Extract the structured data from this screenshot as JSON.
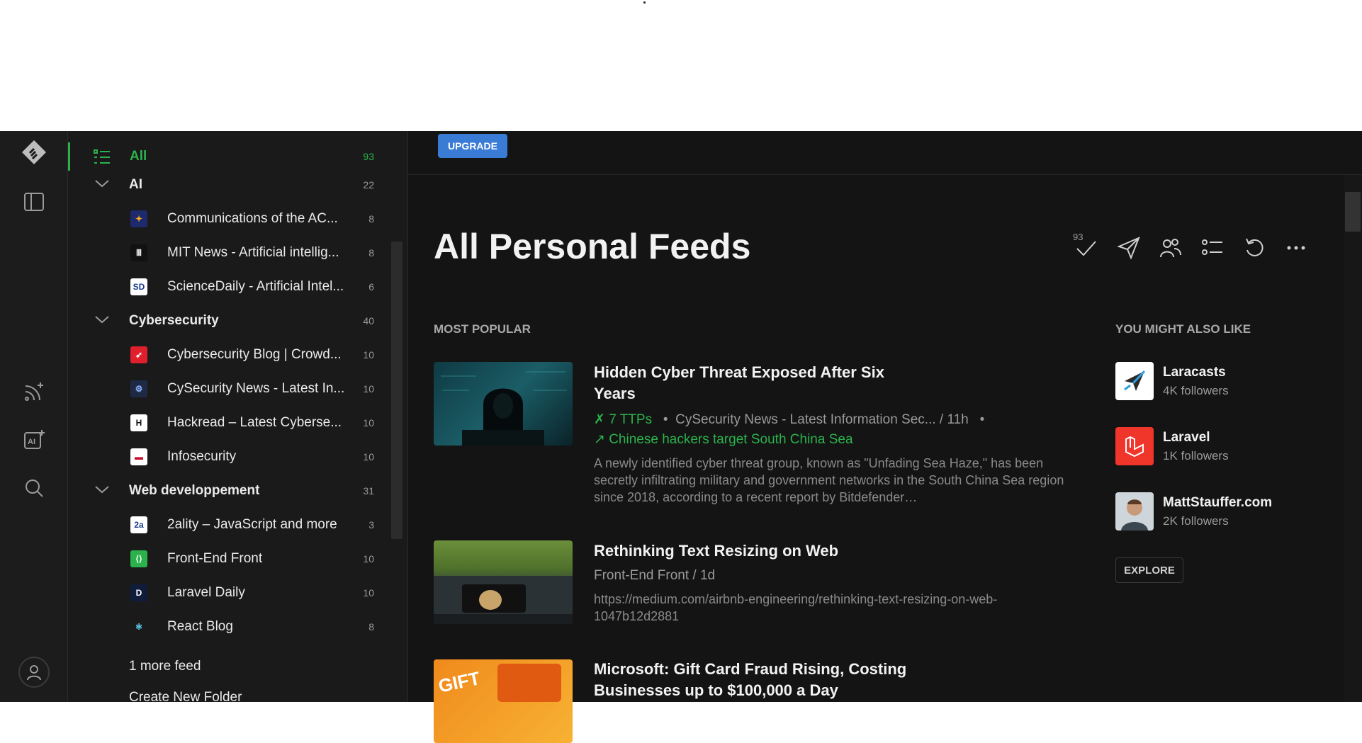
{
  "sidebar": {
    "all": {
      "label": "All",
      "count": "93"
    },
    "items": [
      {
        "type": "folder",
        "label": "AI",
        "count": "22"
      },
      {
        "type": "feed",
        "label": "Communications of the AC...",
        "count": "8",
        "icon": "acm-icon"
      },
      {
        "type": "feed",
        "label": "MIT News - Artificial intellig...",
        "count": "8",
        "icon": "mit-icon"
      },
      {
        "type": "feed",
        "label": "ScienceDaily - Artificial Intel...",
        "count": "6",
        "icon": "sciencedaily-icon"
      },
      {
        "type": "folder",
        "label": "Cybersecurity",
        "count": "40"
      },
      {
        "type": "feed",
        "label": "Cybersecurity Blog | Crowd...",
        "count": "10",
        "icon": "crowdstrike-icon"
      },
      {
        "type": "feed",
        "label": "CySecurity News - Latest In...",
        "count": "10",
        "icon": "cysecurity-icon"
      },
      {
        "type": "feed",
        "label": "Hackread – Latest Cyberse...",
        "count": "10",
        "icon": "hackread-icon"
      },
      {
        "type": "feed",
        "label": "Infosecurity",
        "count": "10",
        "icon": "infosecurity-icon"
      },
      {
        "type": "folder",
        "label": "Web developpement",
        "count": "31"
      },
      {
        "type": "feed",
        "label": "2ality – JavaScript and more",
        "count": "3",
        "icon": "2ality-icon"
      },
      {
        "type": "feed",
        "label": "Front-End Front",
        "count": "10",
        "icon": "frontendfront-icon"
      },
      {
        "type": "feed",
        "label": "Laravel Daily",
        "count": "10",
        "icon": "laraveldaily-icon"
      },
      {
        "type": "feed",
        "label": "React Blog",
        "count": "8",
        "icon": "react-icon"
      }
    ],
    "more": "1 more feed",
    "create_folder": "Create New Folder"
  },
  "main": {
    "upgrade": "UPGRADE",
    "title": "All Personal Feeds",
    "mark_read_count": "93",
    "most_popular": "MOST POPULAR",
    "articles": [
      {
        "title": "Hidden Cyber Threat Exposed After Six Years",
        "ttps": "7 TTPs",
        "source": "CySecurity News - Latest Information Sec... / 11h",
        "trend": "Chinese hackers target South China Sea",
        "desc": "A newly identified cyber threat group, known as \"Unfading Sea Haze,\" has been secretly infiltrating military and government networks in the South China Sea region since 2018, according to a recent report by Bitdefender…"
      },
      {
        "title": "Rethinking Text Resizing on Web",
        "source": "Front-End Front / 1d",
        "desc": "https://medium.com/airbnb-engineering/rethinking-text-resizing-on-web-1047b12d2881"
      },
      {
        "title": "Microsoft: Gift Card Fraud Rising, Costing Businesses up to $100,000 a Day"
      }
    ],
    "suggest_heading": "YOU MIGHT ALSO LIKE",
    "suggestions": [
      {
        "name": "Laracasts",
        "followers": "4K followers"
      },
      {
        "name": "Laravel",
        "followers": "1K followers"
      },
      {
        "name": "MattStauffer.com",
        "followers": "2K followers"
      }
    ],
    "explore": "EXPLORE"
  },
  "colors": {
    "accent": "#2bb24c",
    "upgrade": "#3a7bd5",
    "background": "#141414"
  }
}
